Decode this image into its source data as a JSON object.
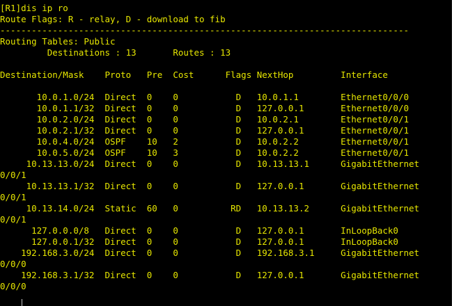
{
  "terminal": {
    "text_color": "#e6e600",
    "background": "#000000",
    "command_line": "[R1]dis ip ro",
    "route_flags": "Route Flags: R - relay, D - download to fib",
    "separator": "------------------------------------------------------------------------------",
    "routing_tables": "Routing Tables: Public",
    "summary": "         Destinations : 13       Routes : 13",
    "column_header": "Destination/Mask    Proto   Pre  Cost      Flags NextHop         Interface",
    "lines": [
      "       10.0.1.0/24  Direct  0    0           D   10.0.1.1        Ethernet0/0/0",
      "       10.0.1.1/32  Direct  0    0           D   127.0.0.1       Ethernet0/0/0",
      "       10.0.2.0/24  Direct  0    0           D   10.0.2.1        Ethernet0/0/1",
      "       10.0.2.1/32  Direct  0    0           D   127.0.0.1       Ethernet0/0/1",
      "       10.0.4.0/24  OSPF    10   2           D   10.0.2.2        Ethernet0/0/1",
      "       10.0.5.0/24  OSPF    10   3           D   10.0.2.2        Ethernet0/0/1",
      "     10.13.13.0/24  Direct  0    0           D   10.13.13.1      GigabitEthernet",
      "0/0/1",
      "     10.13.13.1/32  Direct  0    0           D   127.0.0.1       GigabitEthernet",
      "0/0/1",
      "     10.13.14.0/24  Static  60   0          RD   10.13.13.2      GigabitEthernet",
      "0/0/1",
      "      127.0.0.0/8   Direct  0    0           D   127.0.0.1       InLoopBack0",
      "      127.0.0.1/32  Direct  0    0           D   127.0.0.1       InLoopBack0",
      "    192.168.3.0/24  Direct  0    0           D   192.168.3.1     GigabitEthernet",
      "0/0/0",
      "    192.168.3.1/32  Direct  0    0           D   127.0.0.1       GigabitEthernet",
      "0/0/0"
    ]
  }
}
